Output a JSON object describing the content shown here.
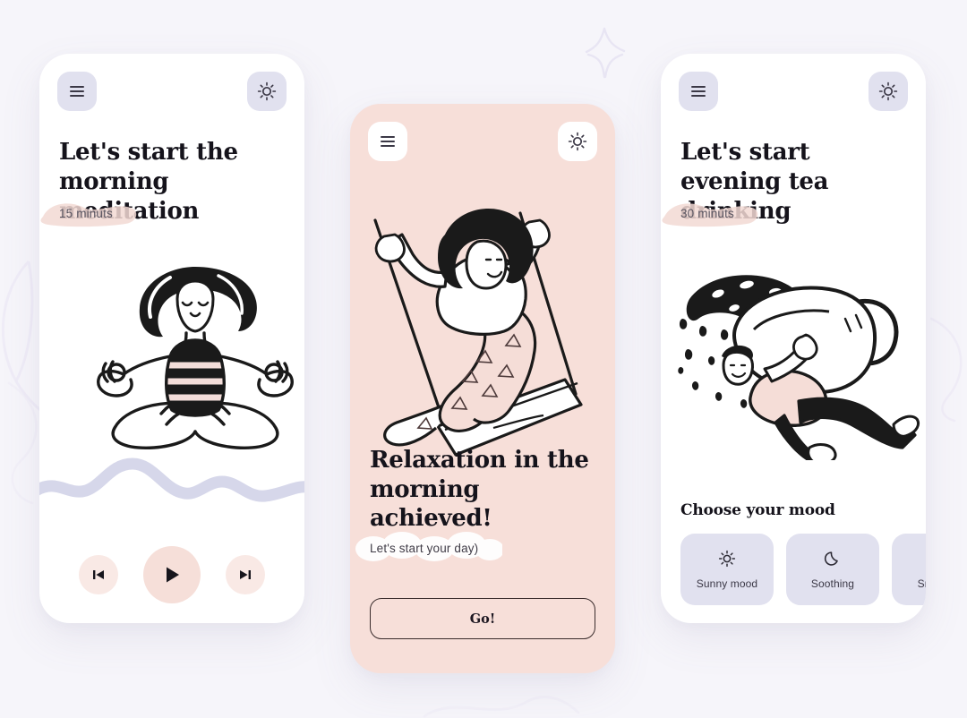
{
  "page": {
    "background_color": "#f6f5fa"
  },
  "colors": {
    "ink": "#15131b",
    "lavender_chip": "#e1e1ef",
    "pink_card": "#f7dfd9",
    "pink_button": "#f9e9e5",
    "pink_button_main": "#f6dfd9",
    "wave_lavender": "#d6d7ea",
    "highlight_pink": "#f4dcd6",
    "outline_dark": "#3a2c2c",
    "card_white": "#ffffff"
  },
  "cards": [
    {
      "id": "morning",
      "menu_icon": "hamburger-icon",
      "theme_icon": "sun-icon",
      "heading": "Let's start the morning meditation",
      "duration": "15 minuts",
      "illustration": "woman-meditating-lotus-pose",
      "player": {
        "previous_label": "previous-track",
        "play_label": "play",
        "next_label": "next-track"
      }
    },
    {
      "id": "relax",
      "menu_icon": "hamburger-icon",
      "theme_icon": "sun-icon",
      "heading": "Relaxation in the morning achieved!",
      "subtitle": "Let's start your day)",
      "illustration": "woman-on-swing",
      "cta_label": "Go!"
    },
    {
      "id": "evening",
      "menu_icon": "hamburger-icon",
      "theme_icon": "sun-icon",
      "heading": "Let's start evening tea drinking",
      "duration": "30 minuts",
      "illustration": "person-carrying-giant-teacup",
      "mood_section_title": "Choose your mood",
      "moods": [
        {
          "label": "Sunny mood",
          "icon": "sun-icon"
        },
        {
          "label": "Soothing",
          "icon": "moon-icon"
        },
        {
          "label": "Snowing",
          "icon": "snowflake-icon"
        }
      ]
    }
  ]
}
